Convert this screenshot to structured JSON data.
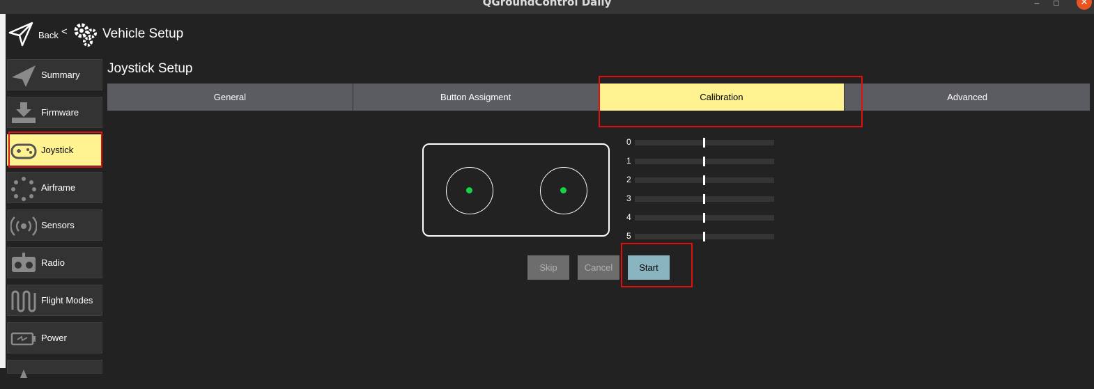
{
  "window": {
    "title": "QGroundControl Daily",
    "minimize_glyph": "–",
    "maximize_glyph": "□",
    "close_glyph": "✕"
  },
  "header": {
    "back_label": "Back",
    "separator": "<",
    "title": "Vehicle Setup"
  },
  "sidebar": {
    "items": [
      {
        "label": "Summary",
        "icon": "paper-plane-icon",
        "active": false
      },
      {
        "label": "Firmware",
        "icon": "download-icon",
        "active": false
      },
      {
        "label": "Joystick",
        "icon": "gamepad-icon",
        "active": true
      },
      {
        "label": "Airframe",
        "icon": "airframe-icon",
        "active": false
      },
      {
        "label": "Sensors",
        "icon": "sensors-icon",
        "active": false
      },
      {
        "label": "Radio",
        "icon": "radio-icon",
        "active": false
      },
      {
        "label": "Flight Modes",
        "icon": "flight-modes-icon",
        "active": false
      },
      {
        "label": "Power",
        "icon": "battery-icon",
        "active": false
      }
    ]
  },
  "page": {
    "title": "Joystick Setup",
    "tabs": [
      {
        "label": "General",
        "active": false
      },
      {
        "label": "Button Assigment",
        "active": false
      },
      {
        "label": "Calibration",
        "active": true
      },
      {
        "label": "Advanced",
        "active": false
      }
    ]
  },
  "calibration": {
    "axes": [
      {
        "label": "0",
        "value": 0.5
      },
      {
        "label": "1",
        "value": 0.5
      },
      {
        "label": "2",
        "value": 0.5
      },
      {
        "label": "3",
        "value": 0.5
      },
      {
        "label": "4",
        "value": 0.5
      },
      {
        "label": "5",
        "value": 0.5
      }
    ],
    "buttons": {
      "skip": "Skip",
      "cancel": "Cancel",
      "start": "Start"
    }
  },
  "colors": {
    "background": "#222222",
    "accent_active": "#fff291",
    "tab_inactive": "#5b5b62",
    "stick_dot": "#16d344",
    "highlight_box": "#e01010",
    "start_button": "#8ab4bf"
  }
}
